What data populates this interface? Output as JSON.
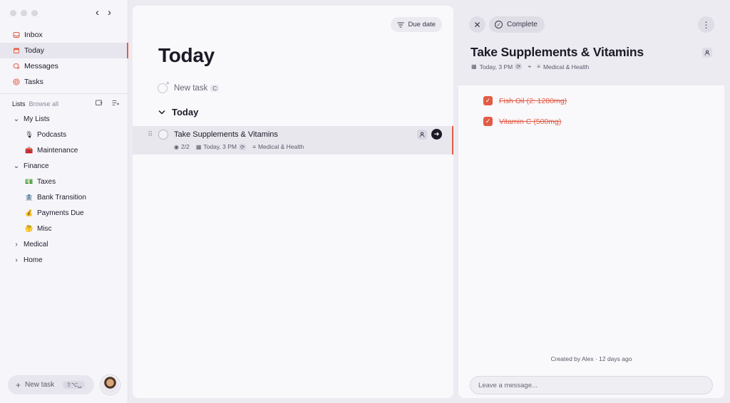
{
  "sidebar": {
    "nav": [
      {
        "label": "Inbox",
        "icon": "inbox-icon"
      },
      {
        "label": "Today",
        "icon": "calendar-icon",
        "active": true
      },
      {
        "label": "Messages",
        "icon": "chat-icon"
      },
      {
        "label": "Tasks",
        "icon": "target-icon"
      }
    ],
    "lists_label": "Lists",
    "browse_all": "Browse all",
    "tree": [
      {
        "label": "My Lists",
        "type": "group",
        "expanded": true
      },
      {
        "label": "Podcasts",
        "type": "child",
        "emoji": "🎙"
      },
      {
        "label": "Maintenance",
        "type": "child",
        "emoji": "🧰"
      },
      {
        "label": "Finance",
        "type": "group",
        "expanded": true
      },
      {
        "label": "Taxes",
        "type": "child",
        "emoji": "💵"
      },
      {
        "label": "Bank Transition",
        "type": "child",
        "emoji": "🏦"
      },
      {
        "label": "Payments Due",
        "type": "child",
        "emoji": "💰"
      },
      {
        "label": "Misc",
        "type": "child",
        "emoji": "🤔"
      },
      {
        "label": "Medical",
        "type": "group",
        "expanded": false
      },
      {
        "label": "Home",
        "type": "group",
        "expanded": false
      }
    ],
    "new_task_label": "New task",
    "new_task_shortcut": "⇧⌥␣"
  },
  "main": {
    "sort_label": "Due date",
    "title": "Today",
    "new_task_placeholder": "New task",
    "new_task_key": "C",
    "section_title": "Today",
    "task": {
      "title": "Take Supplements & Vitamins",
      "progress": "2/2",
      "due": "Today, 3 PM",
      "category": "Medical & Health"
    }
  },
  "detail": {
    "complete_label": "Complete",
    "title": "Take Supplements & Vitamins",
    "due": "Today, 3 PM",
    "category": "Medical & Health",
    "subtasks": [
      {
        "label": "Fish Oil (2: 1280mg)",
        "done": true
      },
      {
        "label": "Vitamin C (500mg)",
        "done": true
      }
    ],
    "created": "Created by Alex · 12 days ago",
    "message_placeholder": "Leave a message..."
  },
  "colors": {
    "accent": "#e25c45",
    "panel": "#f9f8fb",
    "background": "#ecebf1"
  }
}
